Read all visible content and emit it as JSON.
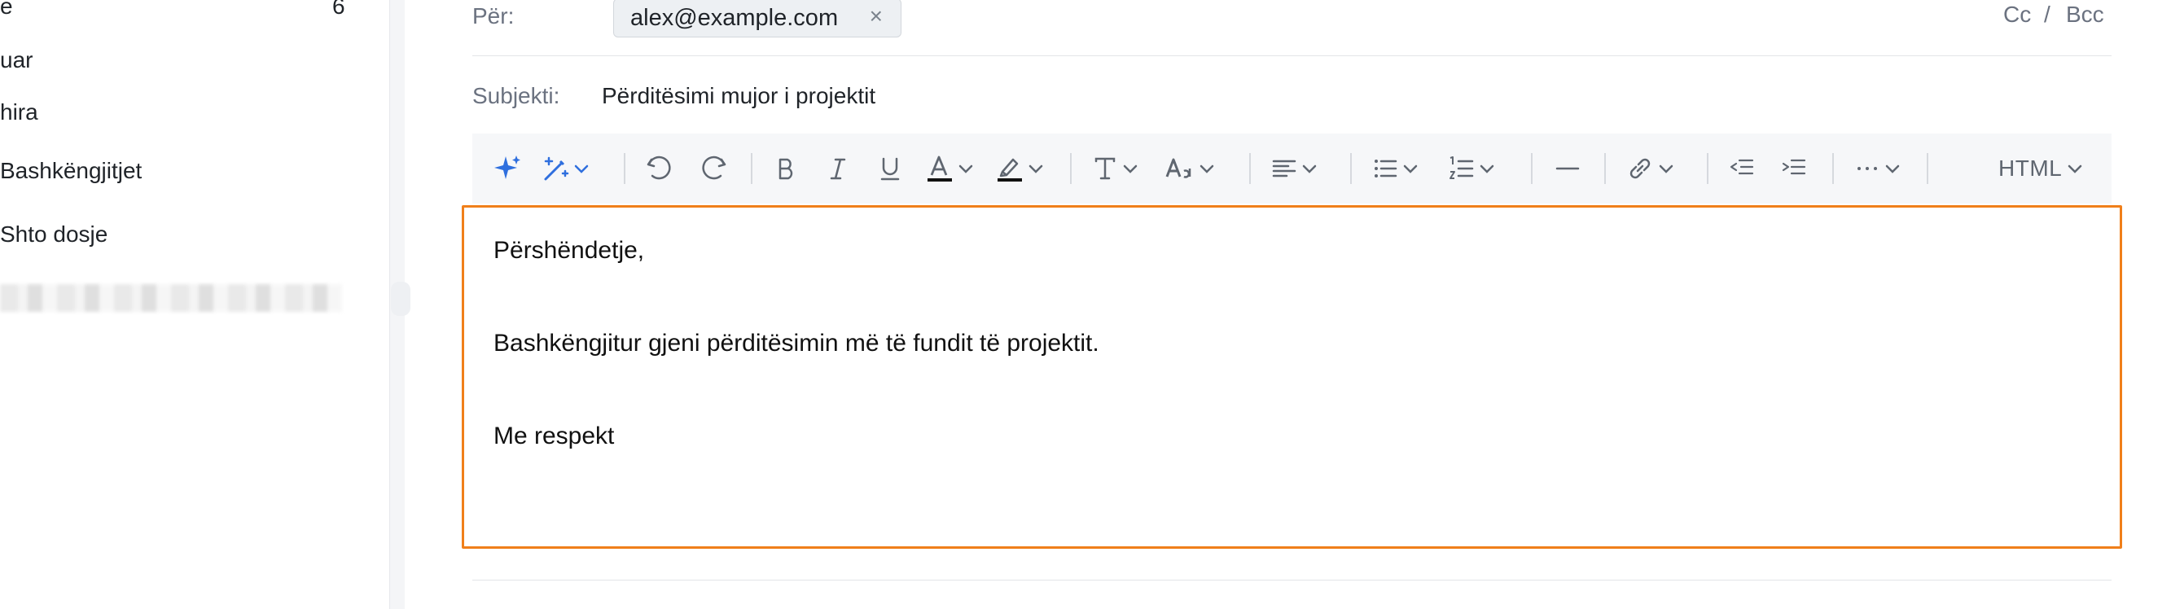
{
  "sidebar": {
    "items": [
      {
        "label": "e",
        "count": "6"
      },
      {
        "label": "uar"
      },
      {
        "label": "hira"
      },
      {
        "label": "Bashkëngjitjet"
      },
      {
        "label": "Shto dosje"
      }
    ]
  },
  "compose": {
    "to_label": "Për:",
    "recipient": "alex@example.com",
    "remove_symbol": "×",
    "cc_label": "Cc",
    "cc_separator": "/",
    "bcc_label": "Bcc",
    "subject_label": "Subjekti:",
    "subject_value": "Përditësimi mujor i projektit"
  },
  "toolbar": {
    "format_label": "HTML",
    "icons": [
      "ai-sparkle-icon",
      "magic-wand-icon",
      "undo-icon",
      "redo-icon",
      "bold-icon",
      "italic-icon",
      "underline-icon",
      "text-color-icon",
      "highlight-icon",
      "font-family-icon",
      "font-size-icon",
      "align-icon",
      "bullet-list-icon",
      "numbered-list-icon",
      "horizontal-rule-icon",
      "link-icon",
      "outdent-icon",
      "indent-icon",
      "more-icon",
      "chevron-down-icon"
    ],
    "colors": {
      "accent": "#2f6fde",
      "icon": "#5f6670",
      "editor_border": "#f07f1a"
    }
  },
  "editor": {
    "lines": [
      "Përshëndetje,",
      "Bashkëngjitur gjeni përditësimin më të fundit të projektit.",
      "Me respekt"
    ]
  }
}
